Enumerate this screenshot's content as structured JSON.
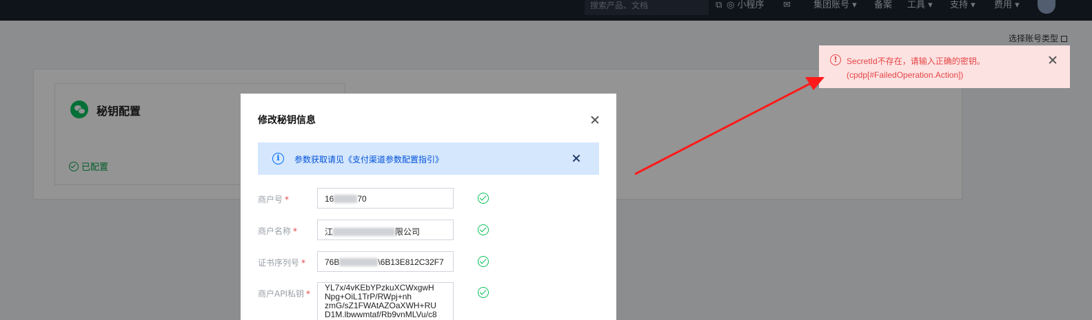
{
  "topnav": {
    "search_placeholder": "搜索产品、文档",
    "items": [
      "小程序",
      "集团账号",
      "备案",
      "工具",
      "支持",
      "费用"
    ]
  },
  "page": {
    "account_type_link": "选择账号类型",
    "card_title": "秘钥配置",
    "card_status": "已配置"
  },
  "modal": {
    "title": "修改秘钥信息",
    "info_text": "参数获取请见《支付渠道参数配置指引》",
    "fields": [
      {
        "label": "商户号",
        "value_prefix": "16",
        "value_suffix": "70"
      },
      {
        "label": "商户名称",
        "value_prefix": "江",
        "value_suffix": "限公司"
      },
      {
        "label": "证书序列号",
        "value_prefix": "76B",
        "value_suffix": "\\6B13E812C32F7"
      },
      {
        "label": "商户API私钥",
        "value": "YL7x/4vKEbYPzkuXCWxgwH Npg+OiL1TrP/RWpj+nh zmG/sZ1FWAtAZOaXWH+RU D1M.lbwwmtaf/Rb9vnMLVu/c8"
      }
    ]
  },
  "toast": {
    "line1": "SecretId不存在，请输入正确的密钥。",
    "line2": "(cpdp[#FailedOperation.Action])"
  },
  "colors": {
    "error": "#e54545",
    "info_bg": "#d5e7fd",
    "success": "#0abf5b",
    "annotation_arrow": "#ff1a1a"
  }
}
